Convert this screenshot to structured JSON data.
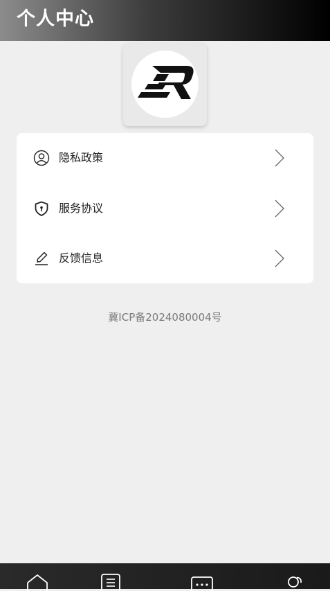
{
  "header": {
    "title": "个人中心"
  },
  "logo": {
    "icon": "sr-logo",
    "text": "SR"
  },
  "menu": {
    "items": [
      {
        "label": "隐私政策",
        "icon": "user-circle-icon"
      },
      {
        "label": "服务协议",
        "icon": "shield-icon"
      },
      {
        "label": "反馈信息",
        "icon": "pencil-icon"
      }
    ]
  },
  "footer": {
    "icp": "冀ICP备2024080004号"
  },
  "tabbar": {
    "tabs": [
      {
        "icon": "home-icon"
      },
      {
        "icon": "document-icon"
      },
      {
        "icon": "message-icon"
      },
      {
        "icon": "users-icon"
      }
    ]
  },
  "colors": {
    "header_start": "#8c8c8c",
    "header_end": "#000000",
    "background": "#efefef",
    "card": "#ffffff",
    "tabbar": "#222222"
  }
}
